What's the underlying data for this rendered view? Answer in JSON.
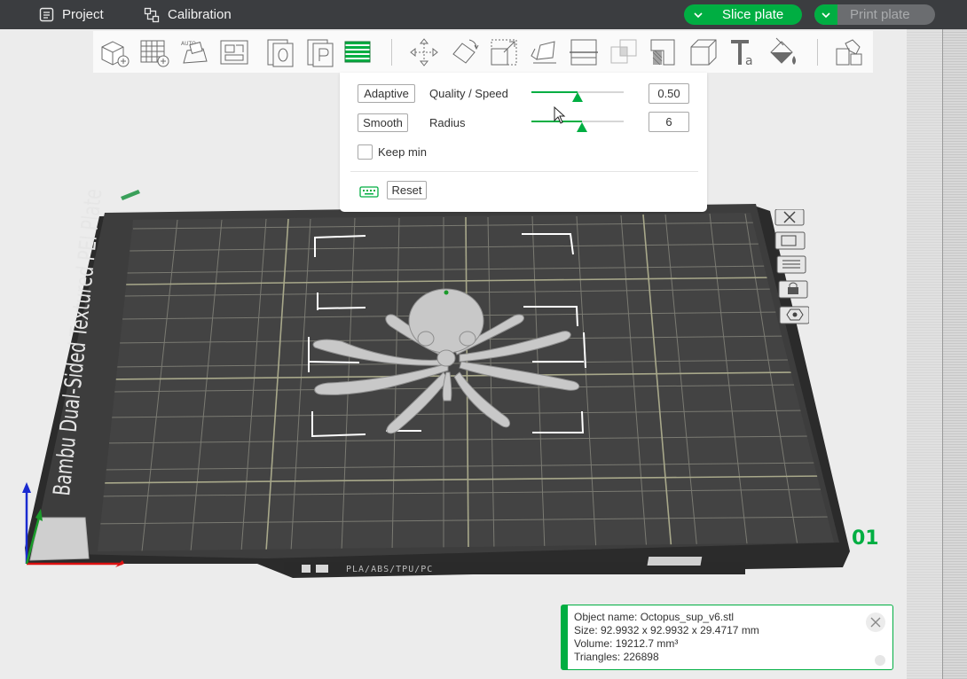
{
  "menu": {
    "project_label": "Project",
    "calibration_label": "Calibration",
    "slice_label": "Slice plate",
    "print_label": "Print plate"
  },
  "toolbar": {
    "icons": [
      "add-object-icon",
      "add-plate-icon",
      "auto-orient-icon",
      "arrange-icon",
      "split-objects-icon",
      "split-parts-icon",
      "variable-layer-height-icon",
      "move-icon",
      "rotate-icon",
      "scale-icon",
      "lay-on-face-icon",
      "cut-icon",
      "mesh-boolean-icon",
      "support-painting-icon",
      "seam-painting-icon",
      "text-icon",
      "color-painting-icon",
      "assembly-icon"
    ]
  },
  "popup": {
    "adaptive_button": "Adaptive",
    "quality_label": "Quality / Speed",
    "quality_value": "0.50",
    "quality_fraction": 0.5,
    "smooth_button": "Smooth",
    "radius_label": "Radius",
    "radius_value": "6",
    "radius_fraction": 0.55,
    "keep_min_label": "Keep min",
    "keep_min_checked": false,
    "reset_button": "Reset"
  },
  "plate": {
    "side_text": "Bambu Dual-Sided Textured PEI Plate",
    "bottom_text": "PLA/ABS/TPU/PC",
    "plate_number": "01",
    "plate_tools": [
      "close-plate-icon",
      "auto-orient-plate-icon",
      "arrange-plate-icon",
      "lock-plate-icon",
      "plate-settings-icon"
    ]
  },
  "info": {
    "object_name": "Object name: Octopus_sup_v6.stl",
    "size": "Size: 92.9932 x 92.9932 x 29.4717 mm",
    "volume": "Volume: 19212.7 mm³",
    "triangles": "Triangles: 226898"
  },
  "colors": {
    "accent": "#00ae42",
    "topbar": "#3b3d40",
    "plate": "#3a3a3a"
  }
}
